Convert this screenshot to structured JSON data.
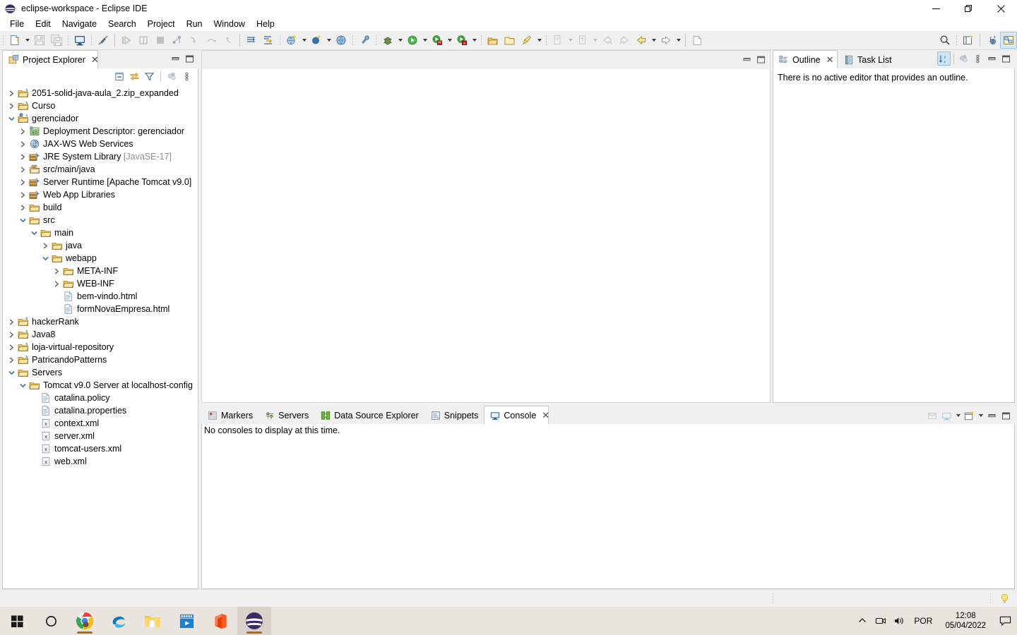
{
  "window": {
    "title": "eclipse-workspace - Eclipse IDE",
    "app_icon": "eclipse-icon",
    "controls": {
      "minimize": "—",
      "restore": "❐",
      "close": "✕"
    }
  },
  "menubar": {
    "items": [
      {
        "label": "File",
        "name": "menu-file"
      },
      {
        "label": "Edit",
        "name": "menu-edit"
      },
      {
        "label": "Navigate",
        "name": "menu-navigate"
      },
      {
        "label": "Search",
        "name": "menu-search"
      },
      {
        "label": "Project",
        "name": "menu-project"
      },
      {
        "label": "Run",
        "name": "menu-run"
      },
      {
        "label": "Window",
        "name": "menu-window"
      },
      {
        "label": "Help",
        "name": "menu-help"
      }
    ]
  },
  "toolbar": {
    "items": [
      "new-wizard-icon",
      "new-wizard-dropdown",
      "save-icon",
      "save-all-icon",
      "open-console-icon",
      "toggle-mark-occurrences-icon",
      "skip-all-breakpoints-icon",
      "resume-icon",
      "suspend-icon",
      "terminate-icon",
      "step-into-icon",
      "step-over-icon",
      "step-return-icon",
      "next-annotation-icon",
      "previous-annotation-icon",
      "new-web-project-icon",
      "new-server-icon",
      "new-web-service-icon",
      "debug-perspective-icon",
      "debug-icon",
      "run-icon",
      "run-server-icon",
      "run-coverage-icon",
      "open-type-icon",
      "open-resource-icon",
      "open-task-icon",
      "new-java-class-icon",
      "new-java-package-icon",
      "back-icon",
      "forward-icon",
      "previous-edit-icon",
      "next-edit-icon",
      "external-tools-icon",
      "search-icon",
      "new-perspective-icon",
      "java-ee-perspective-icon",
      "java-perspective-icon"
    ]
  },
  "project_explorer": {
    "tab_label": "Project Explorer",
    "tab_icon": "project-explorer-icon",
    "close_glyph": "✕",
    "view_toolbar": [
      "collapse-all-icon",
      "link-with-editor-icon",
      "view-filter-icon",
      "focus-on-active-task-icon",
      "view-menu-icon"
    ],
    "window_buttons": [
      "minimize-icon",
      "maximize-icon"
    ],
    "tree": [
      {
        "depth": 0,
        "twist": "collapsed",
        "icon": "java-project-icon",
        "label": "2051-solid-java-aula_2.zip_expanded"
      },
      {
        "depth": 0,
        "twist": "collapsed",
        "icon": "java-project-icon",
        "label": "Curso"
      },
      {
        "depth": 0,
        "twist": "expanded",
        "icon": "dynamic-web-project-icon",
        "label": "gerenciador"
      },
      {
        "depth": 1,
        "twist": "collapsed",
        "icon": "deployment-descriptor-icon",
        "label": "Deployment Descriptor: gerenciador"
      },
      {
        "depth": 1,
        "twist": "collapsed",
        "icon": "jax-ws-icon",
        "label": "JAX-WS Web Services"
      },
      {
        "depth": 1,
        "twist": "collapsed",
        "icon": "library-icon",
        "label": "JRE System Library",
        "suffix": "[JavaSE-17]"
      },
      {
        "depth": 1,
        "twist": "collapsed",
        "icon": "source-folder-icon",
        "label": "src/main/java"
      },
      {
        "depth": 1,
        "twist": "collapsed",
        "icon": "library-icon",
        "label": "Server Runtime [Apache Tomcat v9.0]"
      },
      {
        "depth": 1,
        "twist": "collapsed",
        "icon": "library-icon",
        "label": "Web App Libraries"
      },
      {
        "depth": 1,
        "twist": "collapsed",
        "icon": "folder-icon",
        "label": "build"
      },
      {
        "depth": 1,
        "twist": "expanded",
        "icon": "folder-icon",
        "label": "src"
      },
      {
        "depth": 2,
        "twist": "expanded",
        "icon": "folder-icon",
        "label": "main"
      },
      {
        "depth": 3,
        "twist": "collapsed",
        "icon": "folder-icon",
        "label": "java"
      },
      {
        "depth": 3,
        "twist": "expanded",
        "icon": "folder-icon",
        "label": "webapp"
      },
      {
        "depth": 4,
        "twist": "collapsed",
        "icon": "folder-icon",
        "label": "META-INF"
      },
      {
        "depth": 4,
        "twist": "collapsed",
        "icon": "folder-icon",
        "label": "WEB-INF"
      },
      {
        "depth": 4,
        "twist": "none",
        "icon": "html-file-icon",
        "label": "bem-vindo.html"
      },
      {
        "depth": 4,
        "twist": "none",
        "icon": "html-file-icon",
        "label": "formNovaEmpresa.html"
      },
      {
        "depth": 0,
        "twist": "collapsed",
        "icon": "java-project-icon",
        "label": "hackerRank"
      },
      {
        "depth": 0,
        "twist": "collapsed",
        "icon": "java-project-icon",
        "label": "Java8"
      },
      {
        "depth": 0,
        "twist": "collapsed",
        "icon": "java-project-icon",
        "label": "loja-virtual-repository"
      },
      {
        "depth": 0,
        "twist": "collapsed",
        "icon": "java-project-icon",
        "label": "PatricandoPatterns"
      },
      {
        "depth": 0,
        "twist": "expanded",
        "icon": "folder-icon",
        "label": "Servers"
      },
      {
        "depth": 1,
        "twist": "expanded",
        "icon": "folder-icon",
        "label": "Tomcat v9.0 Server at localhost-config"
      },
      {
        "depth": 2,
        "twist": "none",
        "icon": "text-file-icon",
        "label": "catalina.policy"
      },
      {
        "depth": 2,
        "twist": "none",
        "icon": "text-file-icon",
        "label": "catalina.properties"
      },
      {
        "depth": 2,
        "twist": "none",
        "icon": "xml-file-icon",
        "label": "context.xml"
      },
      {
        "depth": 2,
        "twist": "none",
        "icon": "xml-file-icon",
        "label": "server.xml"
      },
      {
        "depth": 2,
        "twist": "none",
        "icon": "xml-file-icon",
        "label": "tomcat-users.xml"
      },
      {
        "depth": 2,
        "twist": "none",
        "icon": "xml-file-icon",
        "label": "web.xml"
      }
    ]
  },
  "editor_area": {
    "window_buttons": [
      "minimize-icon",
      "maximize-icon"
    ],
    "content": ""
  },
  "outline_panel": {
    "tabs": [
      {
        "label": "Outline",
        "icon": "outline-icon",
        "selected": true,
        "closable": true
      },
      {
        "label": "Task List",
        "icon": "task-list-icon",
        "selected": false,
        "closable": false
      }
    ],
    "close_glyph": "✕",
    "actions": [
      "sort-icon",
      "link-with-editor-icon",
      "view-menu-icon",
      "minimize-icon",
      "maximize-icon"
    ],
    "message": "There is no active editor that provides an outline."
  },
  "bottom_panel": {
    "tabs": [
      {
        "label": "Markers",
        "icon": "markers-icon",
        "selected": false,
        "closable": false
      },
      {
        "label": "Servers",
        "icon": "servers-icon",
        "selected": false,
        "closable": false
      },
      {
        "label": "Data Source Explorer",
        "icon": "data-source-explorer-icon",
        "selected": false,
        "closable": false
      },
      {
        "label": "Snippets",
        "icon": "snippets-icon",
        "selected": false,
        "closable": false
      },
      {
        "label": "Console",
        "icon": "console-icon",
        "selected": true,
        "closable": true
      }
    ],
    "close_glyph": "✕",
    "actions": [
      "open-console-icon",
      "display-selected-console-icon",
      "display-selected-console-dropdown",
      "new-console-view-icon",
      "new-console-view-dropdown",
      "minimize-icon",
      "maximize-icon"
    ],
    "message": "No consoles to display at this time."
  },
  "statusbar": {
    "left_text": "",
    "right_icon": "tip-of-the-day-icon"
  },
  "taskbar": {
    "buttons": [
      {
        "name": "start-button",
        "icon": "windows-logo-icon"
      },
      {
        "name": "search-button",
        "icon": "search-circle-icon"
      },
      {
        "name": "chrome-button",
        "icon": "chrome-icon",
        "running": true
      },
      {
        "name": "edge-button",
        "icon": "edge-icon",
        "running": false
      },
      {
        "name": "file-explorer-button",
        "icon": "file-explorer-icon",
        "running": false
      },
      {
        "name": "movies-tv-button",
        "icon": "movies-tv-icon",
        "running": false
      },
      {
        "name": "office-button",
        "icon": "office-icon",
        "running": false
      },
      {
        "name": "eclipse-button",
        "icon": "eclipse-icon",
        "running": true,
        "active": true
      }
    ],
    "tray": {
      "chevron": "show-hidden-icons-icon",
      "icons": [
        "camera-icon",
        "volume-icon"
      ],
      "language": "POR",
      "time": "12:08",
      "date": "05/04/2022",
      "action_center": "action-center-icon"
    }
  },
  "colors": {
    "toolbar_bg": "#f0f0f0",
    "tab_selected_bg": "#ffffff",
    "tab_border": "#c8c8c8",
    "dim_text": "#8f8f8f",
    "taskbar_bg": "#e9e4dd",
    "accent": "#2a6fb5"
  }
}
